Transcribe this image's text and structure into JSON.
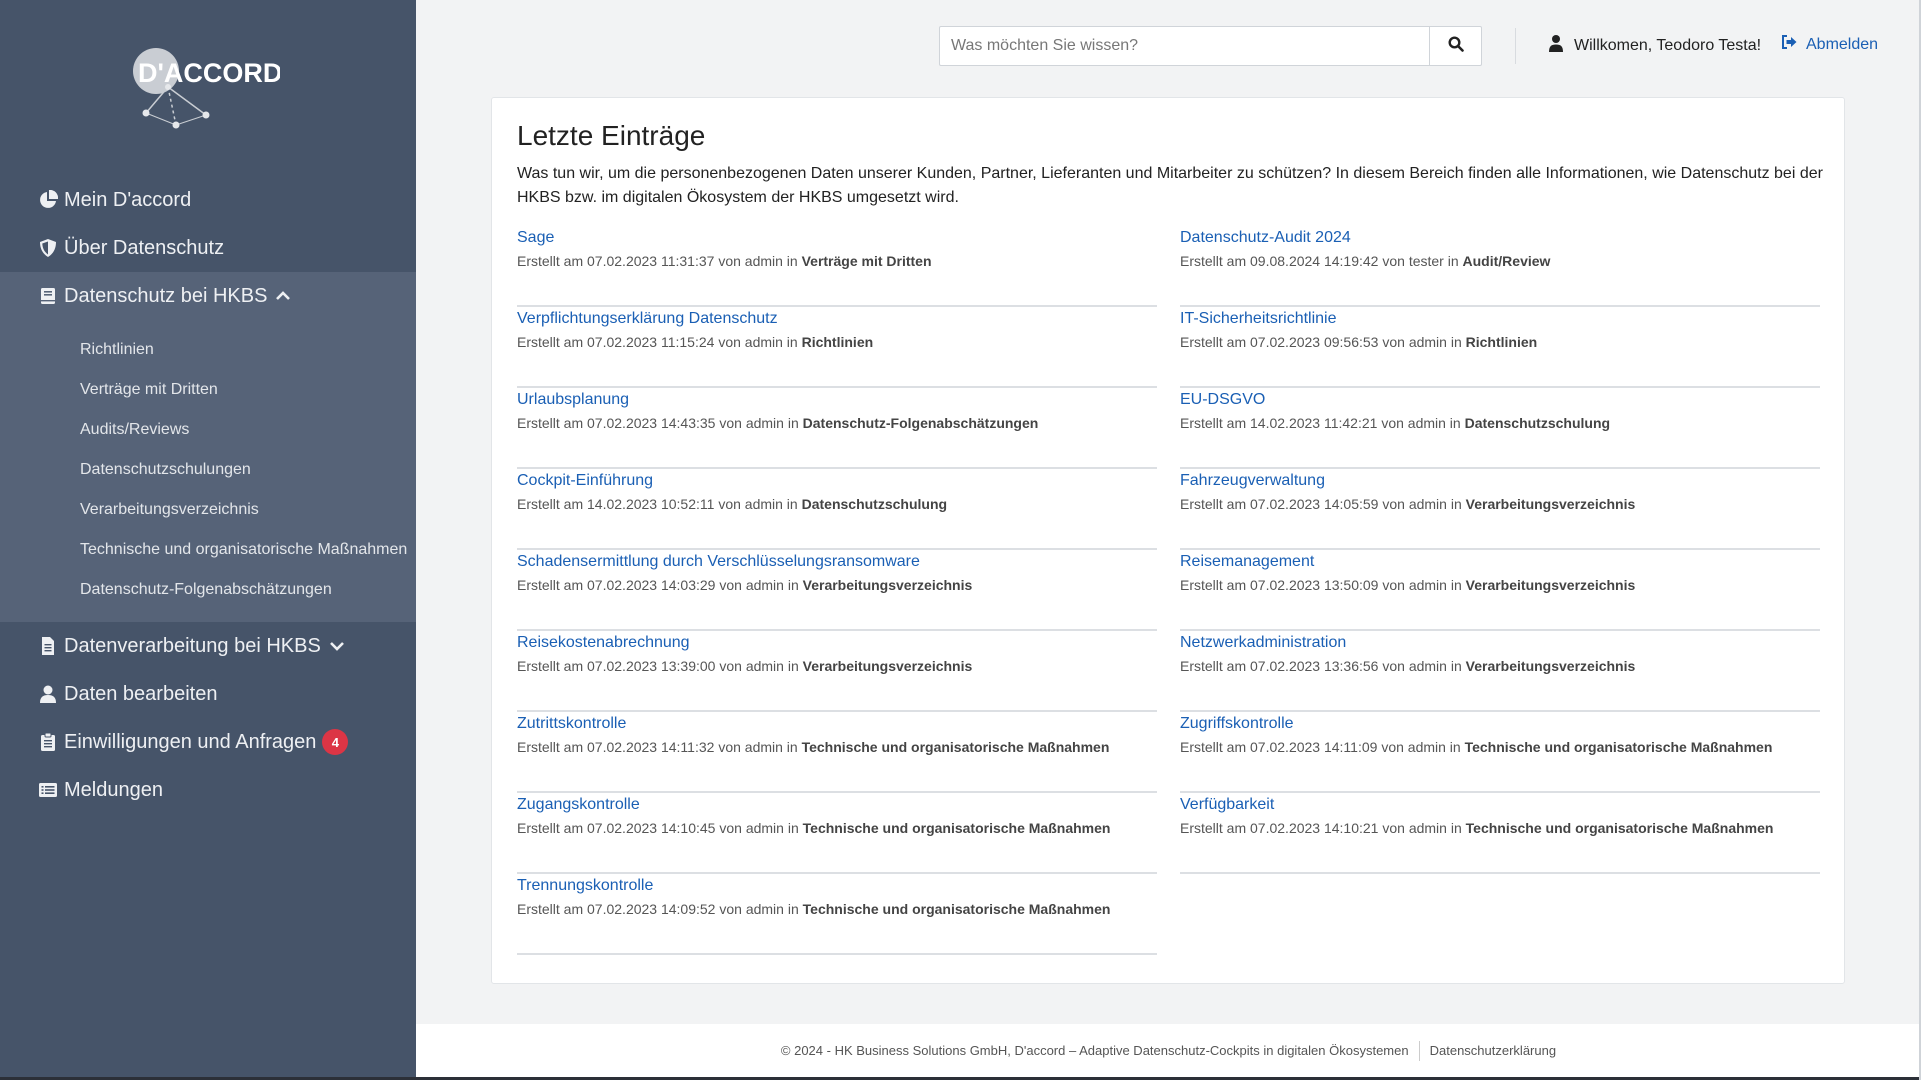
{
  "brand": {
    "logo_text": "D'ACCORD"
  },
  "colors": {
    "sidebar": "#465469",
    "sidebar_group": "#566378",
    "link": "#1a5fb4",
    "badge": "#dc3545"
  },
  "nav": {
    "mein": {
      "label": "Mein D'accord",
      "icon": "pie-chart-icon"
    },
    "ueber": {
      "label": "Über Datenschutz",
      "icon": "shield-icon"
    },
    "datenschutz": {
      "label": "Datenschutz bei HKBS",
      "icon": "book-icon",
      "expanded": true,
      "items": [
        "Richtlinien",
        "Verträge mit Dritten",
        "Audits/Reviews",
        "Datenschutzschulungen",
        "Verarbeitungsverzeichnis",
        "Technische und organisatorische Maßnahmen",
        "Datenschutz-Folgenabschätzungen"
      ]
    },
    "datenverarbeitung": {
      "label": "Datenverarbeitung bei HKBS",
      "icon": "file-icon"
    },
    "daten": {
      "label": "Daten bearbeiten",
      "icon": "user-icon"
    },
    "einwilligungen": {
      "label": "Einwilligungen und Anfragen",
      "icon": "clipboard-icon",
      "badge": "4"
    },
    "meldungen": {
      "label": "Meldungen",
      "icon": "list-icon"
    }
  },
  "header": {
    "search_placeholder": "Was möchten Sie wissen?",
    "search_value": "",
    "welcome": "Willkomen, Teodoro Testa!",
    "logout": "Abmelden"
  },
  "main": {
    "title": "Letzte Einträge",
    "intro": "Was tun wir, um die personenbezogenen Daten unserer Kunden, Partner, Lieferanten und Mitarbeiter zu schützen? In diesem Bereich finden alle Informationen, wie Datenschutz bei der HKBS bzw. im digitalen Ökosystem der HKBS umgesetzt wird.",
    "left": [
      {
        "title": "Sage",
        "meta": "Erstellt am 07.02.2023 11:31:37 von admin in",
        "category": "Verträge mit Dritten"
      },
      {
        "title": "Verpflichtungserklärung Datenschutz",
        "meta": "Erstellt am 07.02.2023 11:15:24 von admin in",
        "category": "Richtlinien"
      },
      {
        "title": "Urlaubsplanung",
        "meta": "Erstellt am 07.02.2023 14:43:35 von admin in",
        "category": "Datenschutz-Folgenabschätzungen"
      },
      {
        "title": "Cockpit-Einführung",
        "meta": "Erstellt am 14.02.2023 10:52:11 von admin in",
        "category": "Datenschutzschulung"
      },
      {
        "title": "Schadensermittlung durch Verschlüsselungsransomware",
        "meta": "Erstellt am 07.02.2023 14:03:29 von admin in",
        "category": "Verarbeitungsverzeichnis"
      },
      {
        "title": "Reisekostenabrechnung",
        "meta": "Erstellt am 07.02.2023 13:39:00 von admin in",
        "category": "Verarbeitungsverzeichnis"
      },
      {
        "title": "Zutrittskontrolle",
        "meta": "Erstellt am 07.02.2023 14:11:32 von admin in",
        "category": "Technische und organisatorische Maßnahmen"
      },
      {
        "title": "Zugangskontrolle",
        "meta": "Erstellt am 07.02.2023 14:10:45 von admin in",
        "category": "Technische und organisatorische Maßnahmen"
      },
      {
        "title": "Trennungskontrolle",
        "meta": "Erstellt am 07.02.2023 14:09:52 von admin in",
        "category": "Technische und organisatorische Maßnahmen"
      }
    ],
    "right": [
      {
        "title": "Datenschutz-Audit 2024",
        "meta": "Erstellt am 09.08.2024 14:19:42 von tester in",
        "category": "Audit/Review"
      },
      {
        "title": "IT-Sicherheitsrichtlinie",
        "meta": "Erstellt am 07.02.2023 09:56:53 von admin in",
        "category": "Richtlinien"
      },
      {
        "title": "EU-DSGVO",
        "meta": "Erstellt am 14.02.2023 11:42:21 von admin in",
        "category": "Datenschutzschulung"
      },
      {
        "title": "Fahrzeugverwaltung",
        "meta": "Erstellt am 07.02.2023 14:05:59 von admin in",
        "category": "Verarbeitungsverzeichnis"
      },
      {
        "title": "Reisemanagement",
        "meta": "Erstellt am 07.02.2023 13:50:09 von admin in",
        "category": "Verarbeitungsverzeichnis"
      },
      {
        "title": "Netzwerkadministration",
        "meta": "Erstellt am 07.02.2023 13:36:56 von admin in",
        "category": "Verarbeitungsverzeichnis"
      },
      {
        "title": "Zugriffskontrolle",
        "meta": "Erstellt am 07.02.2023 14:11:09 von admin in",
        "category": "Technische und organisatorische Maßnahmen"
      },
      {
        "title": "Verfügbarkeit",
        "meta": "Erstellt am 07.02.2023 14:10:21 von admin in",
        "category": "Technische und organisatorische Maßnahmen"
      }
    ]
  },
  "footer": {
    "copyright": "© 2024 - HK Business Solutions GmbH, D'accord – Adaptive Datenschutz-Cockpits in digitalen Ökosystemen",
    "privacy": "Datenschutzerklärung"
  }
}
